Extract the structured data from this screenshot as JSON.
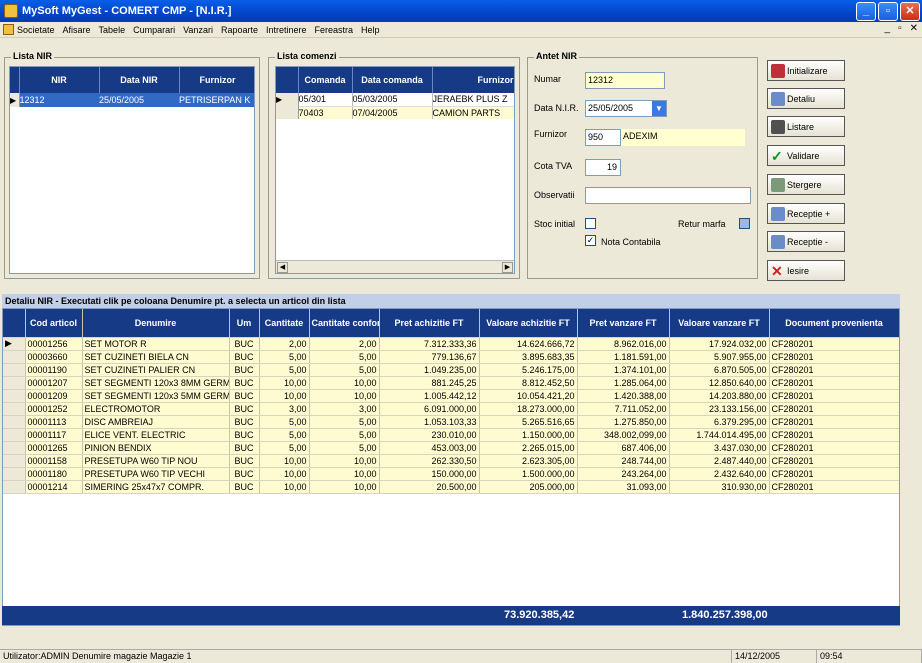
{
  "window": {
    "title": "MySoft MyGest  -  COMERT CMP  -  [N.I.R.]",
    "minimize": "_",
    "maximize": "▫",
    "close": "✕"
  },
  "menu": {
    "items": [
      "Societate",
      "Afisare",
      "Tabele",
      "Cumparari",
      "Vanzari",
      "Rapoarte",
      "Intretinere",
      "Fereastra",
      "Help"
    ],
    "right": [
      "_",
      "▫",
      "✕"
    ]
  },
  "lista_nir": {
    "title": "Lista NIR",
    "columns": [
      "NIR",
      "Data NIR",
      "Furnizor"
    ],
    "rows": [
      {
        "nir": "12312",
        "data": "25/05/2005",
        "furnizor": "PETRISERPAN K"
      }
    ]
  },
  "lista_comenzi": {
    "title": "Lista comenzi",
    "columns": [
      "Comanda",
      "Data comanda",
      "Furnizor"
    ],
    "rows": [
      {
        "comanda": "05/301",
        "data": "05/03/2005",
        "furnizor": "JERAEBK PLUS Z"
      },
      {
        "comanda": "70403",
        "data": "07/04/2005",
        "furnizor": "CAMION PARTS"
      }
    ]
  },
  "antet": {
    "title": "Antet NIR",
    "numar_label": "Numar",
    "numar_value": "12312",
    "data_label": "Data N.I.R.",
    "data_value": "25/05/2005",
    "furnizor_label": "Furnizor",
    "furnizor_code": "950",
    "furnizor_name": "ADEXIM",
    "cota_label": "Cota TVA",
    "cota_value": "19",
    "observatii_label": "Observatii",
    "observatii_value": "",
    "stoc_label": "Stoc initial",
    "retur_label": "Retur marfa",
    "nota_label": "Nota Contabila"
  },
  "buttons": [
    "Initializare",
    "Detaliu",
    "Listare",
    "Validare",
    "Stergere",
    "Receptie +",
    "Receptie -",
    "Iesire"
  ],
  "detail": {
    "caption": "Detaliu NIR - Executati clik pe coloana Denumire pt. a selecta un articol din lista",
    "columns": [
      "Cod articol",
      "Denumire",
      "Um",
      "Cantitate",
      "Cantitate conform",
      "Pret achizitie FT",
      "Valoare achizitie FT",
      "Pret vanzare FT",
      "Valoare vanzare FT",
      "Document provenienta"
    ],
    "rows": [
      [
        "00001256",
        "SET MOTOR R",
        "BUC",
        "2,00",
        "2,00",
        "7.312.333,36",
        "14.624.666,72",
        "8.962.016,00",
        "17.924.032,00",
        "CF280201"
      ],
      [
        "00003660",
        "SET CUZINETI BIELA CN",
        "BUC",
        "5,00",
        "5,00",
        "779.136,67",
        "3.895.683,35",
        "1.181.591,00",
        "5.907.955,00",
        "CF280201"
      ],
      [
        "00001190",
        "SET CUZINETI PALIER CN",
        "BUC",
        "5,00",
        "5,00",
        "1.049.235,00",
        "5.246.175,00",
        "1.374.101,00",
        "6.870.505,00",
        "CF280201"
      ],
      [
        "00001207",
        "SET SEGMENTI 120x3 8MM GERM",
        "BUC",
        "10,00",
        "10,00",
        "881.245,25",
        "8.812.452,50",
        "1.285.064,00",
        "12.850.640,00",
        "CF280201"
      ],
      [
        "00001209",
        "SET SEGMENTI 120x3 5MM GERM",
        "BUC",
        "10,00",
        "10,00",
        "1.005.442,12",
        "10.054.421,20",
        "1.420.388,00",
        "14.203.880,00",
        "CF280201"
      ],
      [
        "00001252",
        "ELECTROMOTOR",
        "BUC",
        "3,00",
        "3,00",
        "6.091.000,00",
        "18.273.000,00",
        "7.711.052,00",
        "23.133.156,00",
        "CF280201"
      ],
      [
        "00001113",
        "DISC AMBREIAJ",
        "BUC",
        "5,00",
        "5,00",
        "1.053.103,33",
        "5.265.516,65",
        "1.275.850,00",
        "6.379.295,00",
        "CF280201"
      ],
      [
        "00001117",
        "ELICE VENT. ELECTRIC",
        "BUC",
        "5,00",
        "5,00",
        "230.010,00",
        "1.150.000,00",
        "348.002,099,00",
        "1.744.014.495,00",
        "CF280201"
      ],
      [
        "00001265",
        "PINION BENDIX",
        "BUC",
        "5,00",
        "5,00",
        "453.003,00",
        "2.265.015,00",
        "687.406,00",
        "3.437.030,00",
        "CF280201"
      ],
      [
        "00001158",
        "PRESETUPA W60 TIP NOU",
        "BUC",
        "10,00",
        "10,00",
        "262.330,50",
        "2.623.305,00",
        "248.744,00",
        "2.487.440,00",
        "CF280201"
      ],
      [
        "00001180",
        "PRESETUPA W60 TIP VECHI",
        "BUC",
        "10,00",
        "10,00",
        "150.000,00",
        "1.500.000,00",
        "243.264,00",
        "2.432.640,00",
        "CF280201"
      ],
      [
        "00001214",
        "SIMERING 25x47x7 COMPR.",
        "BUC",
        "10,00",
        "10,00",
        "20.500,00",
        "205.000,00",
        "31.093,00",
        "310.930,00",
        "CF280201"
      ]
    ],
    "total_achizitie": "73.920.385,42",
    "total_vanzare": "1.840.257.398,00"
  },
  "status": {
    "user": "Utilizator:ADMIN  Denumire magazie Magazie 1",
    "date": "14/12/2005",
    "time": "09:54"
  }
}
